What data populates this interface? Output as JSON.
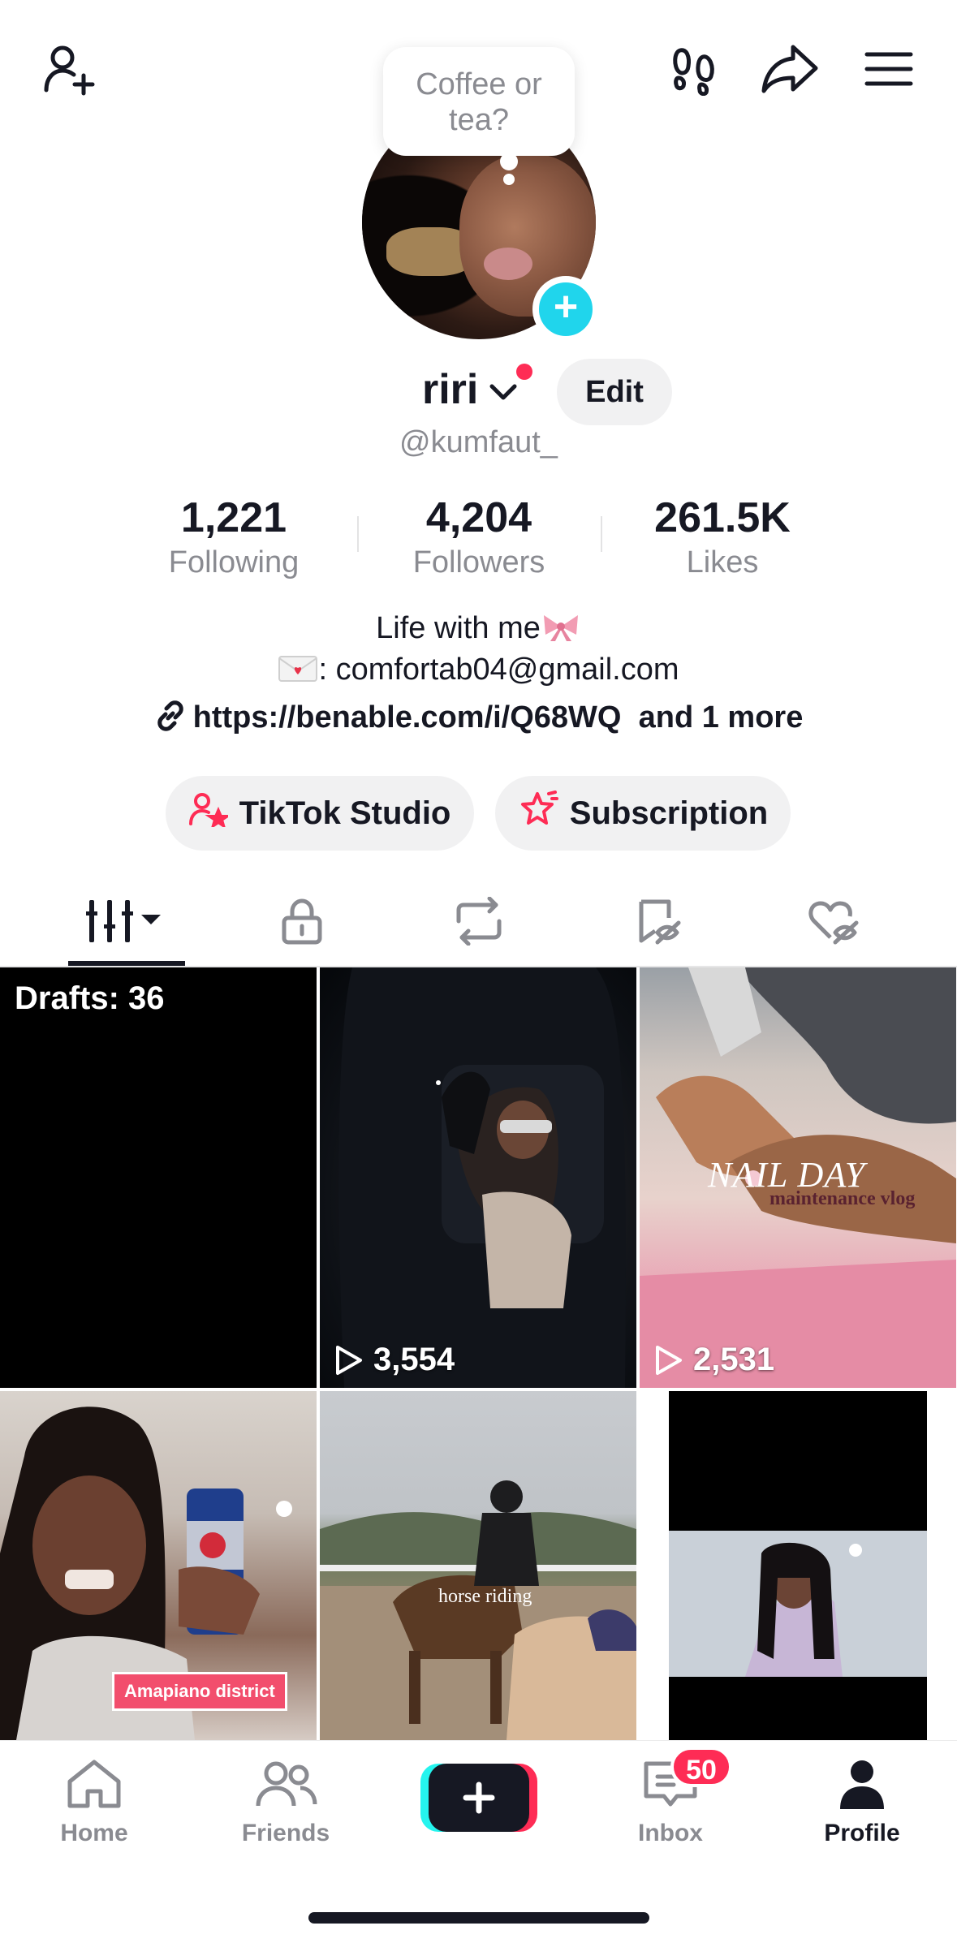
{
  "top_bar": {
    "icons": [
      "add-friend-icon",
      "footprint-icon",
      "share-icon",
      "menu-icon"
    ]
  },
  "bubble": {
    "text": "Coffee or tea?"
  },
  "profile": {
    "name": "riri",
    "edit_label": "Edit",
    "handle": "@kumfaut_"
  },
  "stats": [
    {
      "value": "1,221",
      "label": "Following"
    },
    {
      "value": "4,204",
      "label": "Followers"
    },
    {
      "value": "261.5K",
      "label": "Likes"
    }
  ],
  "bio": {
    "line1": "Life with me",
    "line2": ": comfortab04@gmail.com",
    "link": "https://benable.com/i/Q68WQ",
    "link_more": "and 1 more"
  },
  "actions": {
    "studio_label": "TikTok Studio",
    "subscription_label": "Subscription"
  },
  "tabs": [
    "videos-grid",
    "private",
    "reposts",
    "favorites",
    "liked"
  ],
  "grid": {
    "drafts_label": "Drafts: 36",
    "tiles": [
      {
        "views": "3,554"
      },
      {
        "views": "2,531"
      }
    ],
    "nail_overlay": "NAIL DAY",
    "nail_sub": "maintenance vlog",
    "girl_caption": "Amapiano district",
    "horse_caption": "horse riding"
  },
  "bottom_nav": {
    "home": "Home",
    "friends": "Friends",
    "inbox": "Inbox",
    "inbox_badge": "50",
    "profile": "Profile"
  },
  "colors": {
    "accent_red": "#fe2c55",
    "accent_cyan": "#20d5ec",
    "text_primary": "#161823",
    "text_secondary": "#8a8b91"
  }
}
